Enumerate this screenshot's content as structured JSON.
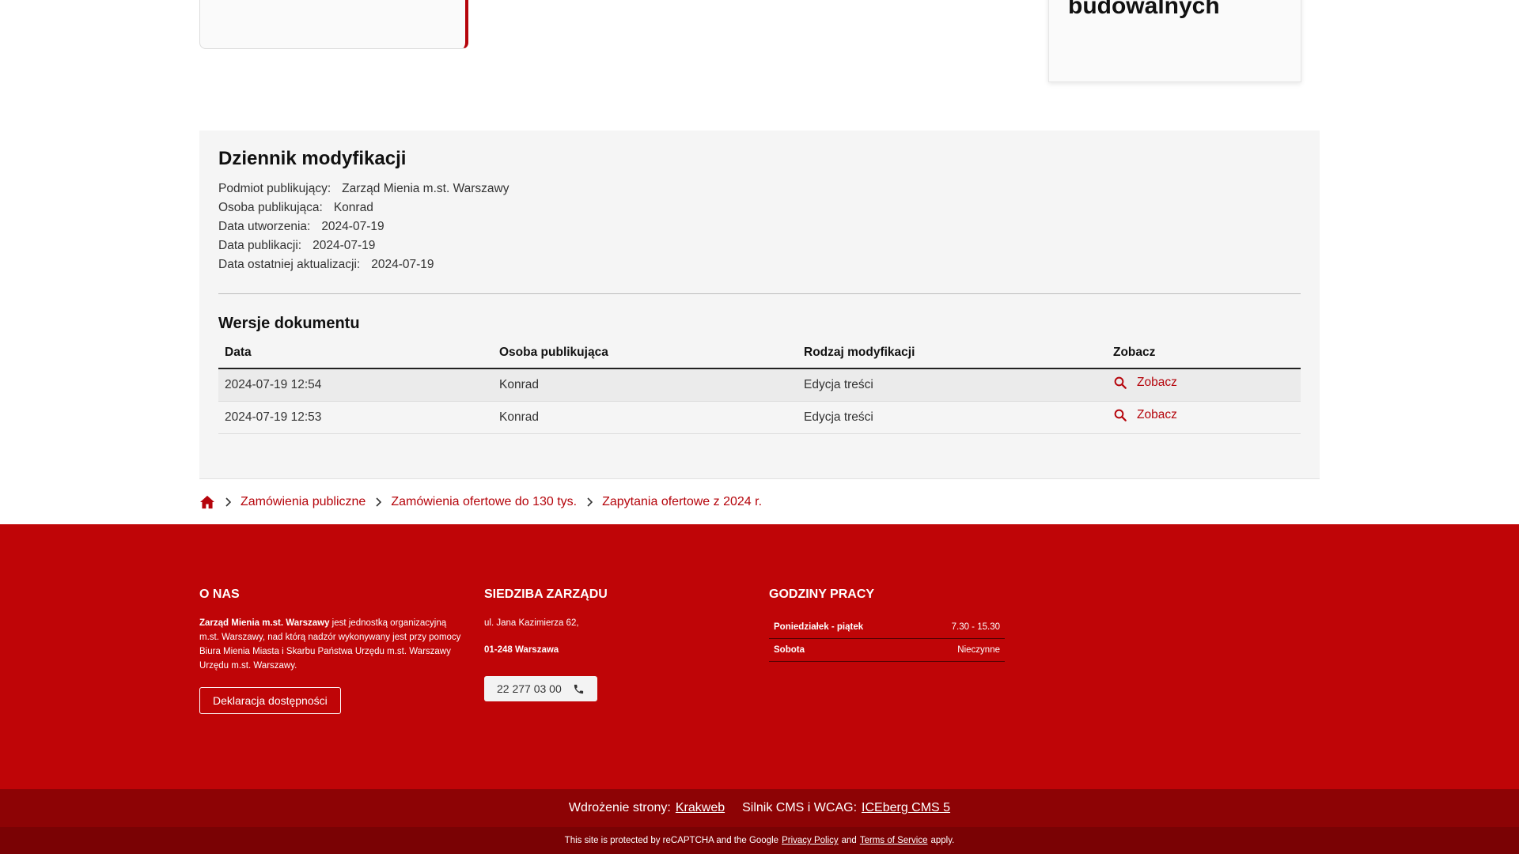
{
  "top_right_card": {
    "title": "budowalnych"
  },
  "log": {
    "title": "Dziennik modyfikacji",
    "meta": [
      {
        "label": "Podmiot publikujący:",
        "value": "Zarząd Mienia m.st. Warszawy"
      },
      {
        "label": "Osoba publikująca:",
        "value": "Konrad"
      },
      {
        "label": "Data utworzenia:",
        "value": "2024-07-19"
      },
      {
        "label": "Data publikacji:",
        "value": "2024-07-19"
      },
      {
        "label": "Data ostatniej aktualizacji:",
        "value": "2024-07-19"
      }
    ],
    "versions_title": "Wersje dokumentu",
    "columns": [
      "Data",
      "Osoba publikująca",
      "Rodzaj modyfikacji",
      "Zobacz"
    ],
    "rows": [
      {
        "date": "2024-07-19 12:54",
        "person": "Konrad",
        "type": "Edycja treści",
        "view": "Zobacz"
      },
      {
        "date": "2024-07-19 12:53",
        "person": "Konrad",
        "type": "Edycja treści",
        "view": "Zobacz"
      }
    ]
  },
  "breadcrumb": {
    "home_icon": "home-icon",
    "items": [
      "Zamówienia publiczne",
      "Zamówienia ofertowe do 130 tys.",
      "Zapytania ofertowe z 2024 r."
    ]
  },
  "footer": {
    "about": {
      "heading": "O NAS",
      "text_bold": "Zarząd Mienia m.st. Warszawy",
      "text_rest": " jest jednostką organizacyjną m.st. Warszawy, nad którą nadzór wykonywany jest przy pomocy Biura Mienia Miasta i Skarbu Państwa Urzędu m.st. Warszawy Urzędu m.st. Warszawy.",
      "button": "Deklaracja dostępności"
    },
    "hq": {
      "heading": "SIEDZIBA ZARZĄDU",
      "street": "ul. Jana Kazimierza 62,",
      "city": "01-248 Warszawa",
      "phone": "22 277 03 00",
      "phone_icon": "phone-icon"
    },
    "hours": {
      "heading": "GODZINY PRACY",
      "rows": [
        {
          "day": "Poniedziałek - piątek",
          "time": "7.30 - 15.30"
        },
        {
          "day": "Sobota",
          "time": "Nieczynne"
        }
      ]
    },
    "credits": {
      "deploy_label": "Wdrożenie strony:",
      "deploy_link": "Krakweb",
      "cms_label": "Silnik CMS i WCAG:",
      "cms_link": "ICEberg CMS 5"
    },
    "recaptcha": {
      "prefix": "This site is protected by reCAPTCHA and the Google",
      "privacy": "Privacy Policy",
      "and": "and",
      "terms": "Terms of Service",
      "suffix": "apply."
    }
  },
  "colors": {
    "accent": "#b5040b",
    "footer_bg": "#bf0507",
    "footer_dark": "#8d0305",
    "footer_darkest": "#7a0204",
    "panel_bg": "#f5f5f5"
  }
}
